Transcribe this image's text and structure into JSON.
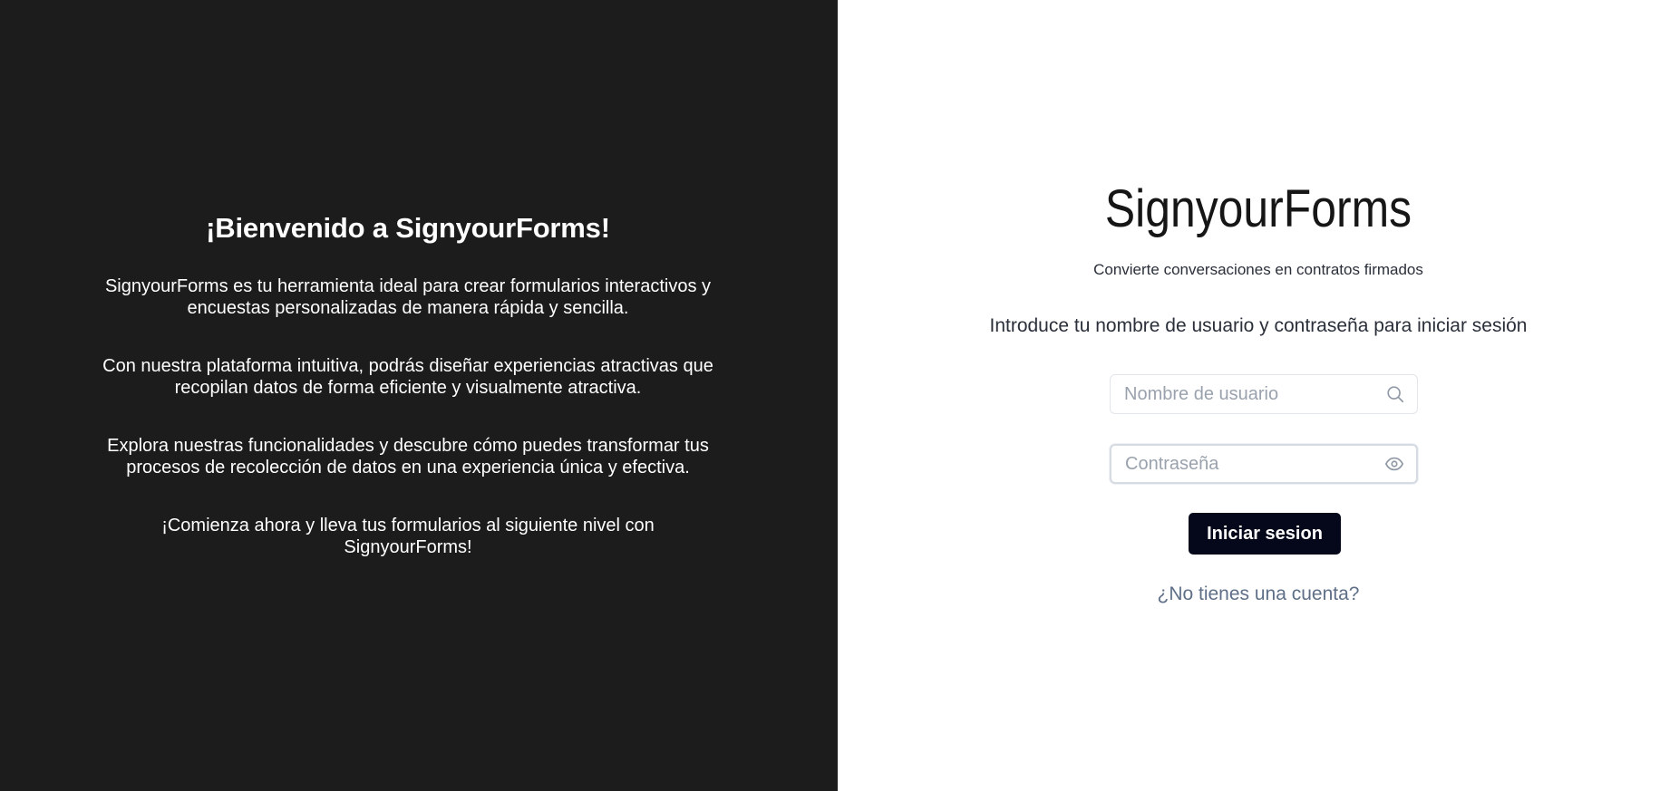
{
  "welcome": {
    "title": "¡Bienvenido a SignyourForms!",
    "paragraphs": [
      "SignyourForms es tu herramienta ideal para crear formularios interactivos y encuestas personalizadas de manera rápida y sencilla.",
      "Con nuestra plataforma intuitiva, podrás diseñar experiencias atractivas que recopilan datos de forma eficiente y visualmente atractiva.",
      "Explora nuestras funcionalidades y descubre cómo puedes transformar tus procesos de recolección de datos en una experiencia única y efectiva.",
      "¡Comienza ahora y lleva tus formularios al siguiente nivel con SignyourForms!"
    ]
  },
  "login": {
    "brand": "SignyourForms",
    "tagline": "Convierte conversaciones en contratos firmados",
    "instructions": "Introduce tu nombre de usuario y contraseña para iniciar sesión",
    "username": {
      "placeholder": "Nombre de usuario",
      "value": "",
      "icon": "search-icon"
    },
    "password": {
      "placeholder": "Contraseña",
      "value": "",
      "icon": "eye-icon"
    },
    "submit_label": "Iniciar sesion",
    "signup_link": "¿No tienes una cuenta?"
  },
  "colors": {
    "left_background": "#1c1c1c",
    "button_background": "#05081a",
    "link_color": "#5e6f87"
  }
}
